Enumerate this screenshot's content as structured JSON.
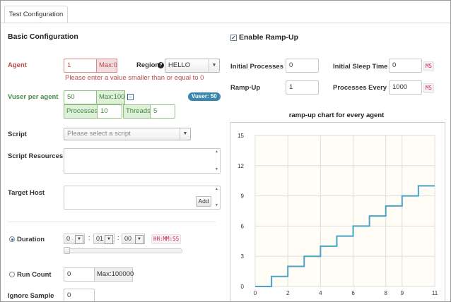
{
  "tab": {
    "label": "Test Configuration"
  },
  "basic": {
    "title": "Basic Configuration",
    "agent": {
      "label": "Agent",
      "value": "1",
      "max_label": "Max:0",
      "error": "Please enter a value smaller than or equal to 0"
    },
    "region": {
      "label": "Region",
      "help": "?",
      "value": "HELLO"
    },
    "vuser": {
      "label": "Vuser per agent",
      "value": "50",
      "max_label": "Max:100",
      "badge": "Vuser: 50",
      "processes_label": "Processes",
      "processes_value": "10",
      "threads_label": "Threads",
      "threads_value": "5"
    },
    "script": {
      "label": "Script",
      "placeholder": "Please select a script"
    },
    "script_resources": {
      "label": "Script Resources"
    },
    "target_host": {
      "label": "Target Host",
      "add_label": "Add"
    },
    "duration": {
      "label": "Duration",
      "hours": "0",
      "minutes": "01",
      "seconds": "00",
      "sep": ":",
      "format": "HH:MM:SS",
      "selected": true
    },
    "run_count": {
      "label": "Run Count",
      "value": "0",
      "max_label": "Max:100000",
      "selected": false
    },
    "ignore_sample": {
      "label": "Ignore Sample",
      "value": "0"
    }
  },
  "rampup": {
    "enable_label": "Enable Ramp-Up",
    "enabled": true,
    "initial_processes": {
      "label": "Initial Processes",
      "value": "0"
    },
    "initial_sleep": {
      "label": "Initial Sleep Time",
      "value": "0",
      "unit": "MS"
    },
    "rampup": {
      "label": "Ramp-Up",
      "value": "1"
    },
    "processes_every": {
      "label": "Processes Every",
      "value": "1000",
      "unit": "MS"
    }
  },
  "chart_data": {
    "type": "line",
    "title": "ramp-up chart for every agent",
    "x": [
      0,
      1,
      1,
      2,
      2,
      3,
      3,
      4,
      4,
      5,
      5,
      6,
      6,
      7,
      7,
      8,
      8,
      9,
      9,
      10,
      10,
      11
    ],
    "y": [
      0,
      0,
      1,
      1,
      2,
      2,
      3,
      3,
      4,
      4,
      5,
      5,
      6,
      6,
      7,
      7,
      8,
      8,
      9,
      9,
      10,
      10
    ],
    "xticks": [
      "0",
      "2",
      "4",
      "6",
      "8",
      "9",
      "11"
    ],
    "xtick_values": [
      0,
      2,
      4,
      6,
      8,
      9,
      11
    ],
    "yticks": [
      "0",
      "3",
      "6",
      "9",
      "12",
      "15"
    ],
    "ytick_values": [
      0,
      3,
      6,
      9,
      12,
      15
    ],
    "xlim": [
      0,
      11
    ],
    "ylim": [
      0,
      15
    ],
    "grid": true,
    "line_color": "#4aa3c8",
    "background": "#fffdf5"
  },
  "colors": {
    "error": "#b94a48",
    "success": "#468847",
    "badge": "#3a87ad"
  }
}
